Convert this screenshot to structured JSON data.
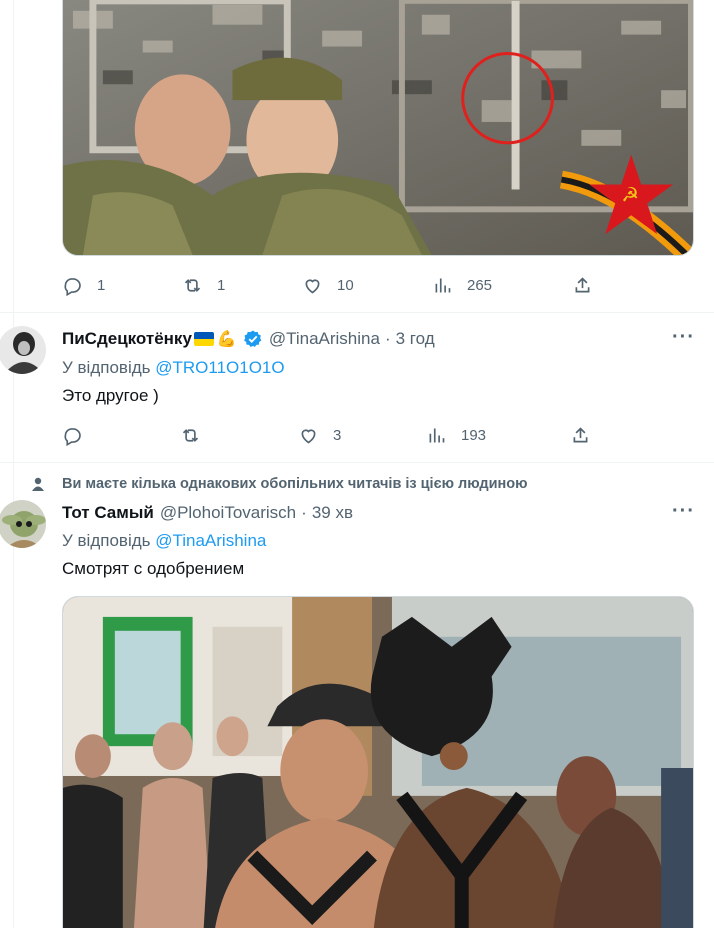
{
  "tweet1": {
    "actions": {
      "replies": "1",
      "retweets": "1",
      "likes": "10",
      "views": "265"
    }
  },
  "tweet2": {
    "display_name": "ПиСдецкотёнку",
    "handle": "@TinaArishina",
    "separator": "·",
    "time": "3 год",
    "reply_prefix": "У відповідь",
    "reply_to": "@TRO11O1O1O",
    "text": "Это другое )",
    "actions": {
      "replies": "",
      "retweets": "",
      "likes": "3",
      "views": "193"
    }
  },
  "tweet3": {
    "social_context": "Ви маєте кілька однакових обопільних читачів із цією людиною",
    "display_name": "Тот Самый",
    "handle": "@PlohoiTovarisch",
    "separator": "·",
    "time": "39 хв",
    "reply_prefix": "У відповідь",
    "reply_to": "@TinaArishina",
    "text": "Смотрят с одобрением"
  },
  "colors": {
    "accent": "#1d9bf0",
    "secondary_text": "#536471",
    "verified": "#1d9bf0"
  },
  "icons": [
    "reply-icon",
    "retweet-icon",
    "like-icon",
    "views-icon",
    "share-icon",
    "more-icon",
    "verified-icon",
    "person-icon"
  ]
}
